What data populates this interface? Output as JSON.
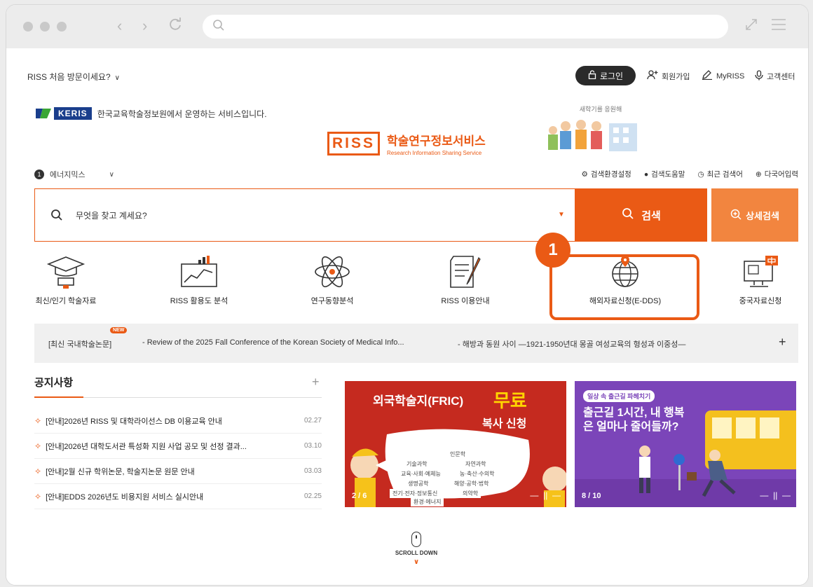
{
  "header": {
    "first_visit": "RISS 처음 방문이세요?",
    "login": "로그인",
    "signup": "회원가입",
    "myriss": "MyRISS",
    "support": "고객센터"
  },
  "brand": {
    "keris_badge": "KERIS",
    "keris_text": "한국교육학술정보원에서 운영하는 서비스입니다.",
    "riss_mark": "RISS",
    "riss_title": "학술연구정보서비스",
    "riss_subtitle": "Research Information Sharing Service",
    "promo_caption": "새학기를 응원해"
  },
  "lang": {
    "number": "1",
    "selected": "에너지믹스"
  },
  "tools": {
    "settings": "검색환경설정",
    "help": "검색도움말",
    "recent": "최근 검색어",
    "multilang": "다국어입력"
  },
  "search": {
    "placeholder": "무엇을 찾고 계세요?",
    "button": "검색",
    "advanced": "상세검색"
  },
  "quick_menu": [
    {
      "label": "최신/인기 학술자료",
      "icon": "graduation-cap-icon"
    },
    {
      "label": "RISS 활용도 분석",
      "icon": "analytics-chart-icon"
    },
    {
      "label": "연구동향분석",
      "icon": "atom-icon"
    },
    {
      "label": "RISS 이용안내",
      "icon": "document-pen-icon"
    },
    {
      "label": "해외자료신청(E-DDS)",
      "icon": "globe-pin-icon"
    },
    {
      "label": "중국자료신청",
      "icon": "chinese-monitor-icon"
    }
  ],
  "step_badge": "1",
  "ticker": {
    "label": "[최신 국내학술논문]",
    "new_badge": "NEW",
    "item1": "- Review of the 2025 Fall Conference of the Korean Society of Medical Info...",
    "item2": "- 해방과 동원 사이 ―1921-1950년대 몽골 여성교육의 형성과 이중성―"
  },
  "notice": {
    "title": "공지사항",
    "items": [
      {
        "title": "[안내]2026년 RISS 및 대학라이선스 DB 이용교육 안내",
        "date": "02.27"
      },
      {
        "title": "[안내]2026년 대학도서관 특성화 지원 사업 공모 및 선정 결과...",
        "date": "03.10"
      },
      {
        "title": "[안내]2월 신규 학위논문, 학술지논문 원문 안내",
        "date": "03.03"
      },
      {
        "title": "[안내]EDDS 2026년도 비용지원 서비스 실시안내",
        "date": "02.25"
      }
    ]
  },
  "banner1": {
    "title": "외국학술지(FRIC)",
    "free": "무료",
    "subtitle": "복사 신청",
    "tags": [
      "인문학",
      "기술과학",
      "자연과학",
      "교육·사회·예체능",
      "농·축산·수의학",
      "생명공학",
      "해양·공학·법학",
      "전기·전자·정보통신",
      "의약학",
      "환경·에너지"
    ],
    "counter": "2 / 6"
  },
  "banner2": {
    "chip": "일상 속 출근길 파헤치기",
    "headline": "출근길 1시간, 내 행복은 얼마나 줄어들까?",
    "counter": "8 / 10"
  },
  "scroll": {
    "label": "SCROLL DOWN"
  },
  "colors": {
    "accent": "#ea5a15",
    "accent_light": "#f2853f",
    "keris_blue": "#1a3e8c"
  }
}
